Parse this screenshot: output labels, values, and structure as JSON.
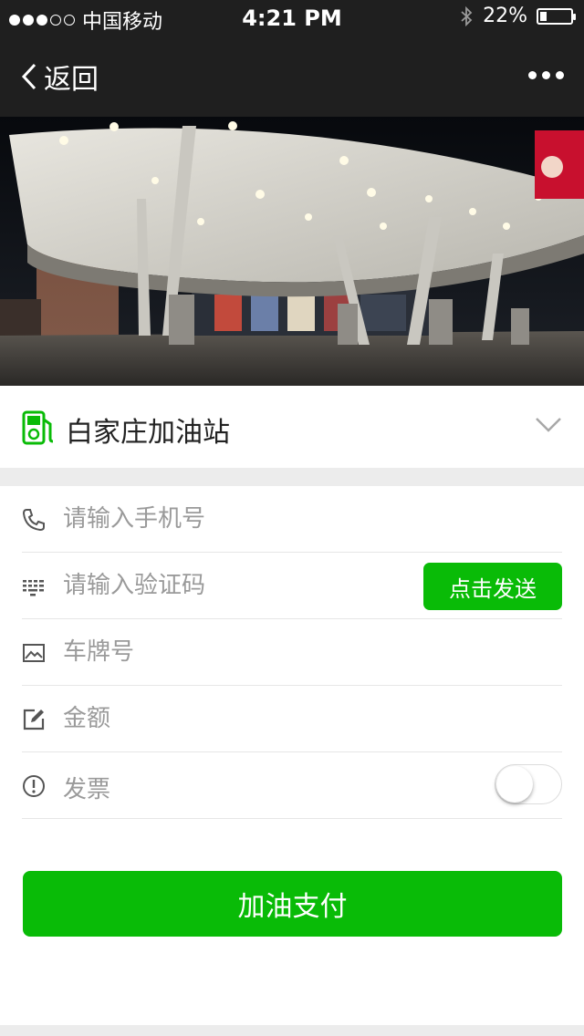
{
  "status_bar": {
    "carrier": "中国移动",
    "time": "4:21 PM",
    "battery": "22%",
    "battery_level": 0.22
  },
  "nav": {
    "back_label": "返回"
  },
  "station": {
    "name": "白家庄加油站"
  },
  "form": {
    "phone_placeholder": "请输入手机号",
    "code_placeholder": "请输入验证码",
    "send_button": "点击发送",
    "plate_placeholder": "车牌号",
    "amount_placeholder": "金额",
    "invoice_label": "发票",
    "invoice_on": false
  },
  "pay_button": "加油支付",
  "colors": {
    "accent": "#09bb07",
    "bar": "#1f1f1f"
  }
}
